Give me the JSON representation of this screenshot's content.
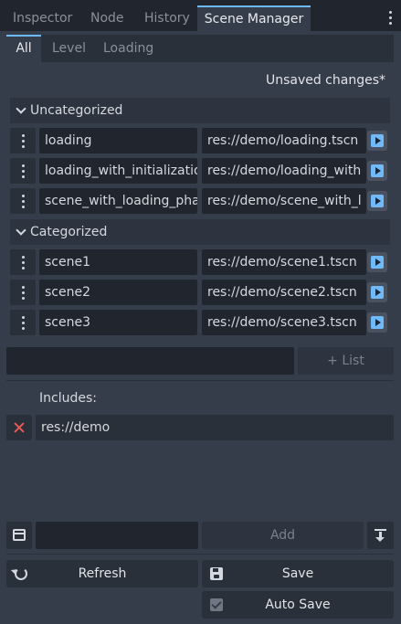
{
  "dock": {
    "tabs": [
      "Inspector",
      "Node",
      "History",
      "Scene Manager"
    ],
    "active_tab": "Scene Manager"
  },
  "sub_tabs": [
    "All",
    "Level",
    "Loading"
  ],
  "status": {
    "unsaved": "Unsaved changes*"
  },
  "sections": [
    {
      "title": "Uncategorized",
      "rows": [
        {
          "name": "loading",
          "path": "res://demo/loading.tscn"
        },
        {
          "name": "loading_with_initializatio",
          "path": "res://demo/loading_with"
        },
        {
          "name": "scene_with_loading_pha",
          "path": "res://demo/scene_with_l"
        }
      ]
    },
    {
      "title": "Categorized",
      "rows": [
        {
          "name": "scene1",
          "path": "res://demo/scene1.tscn"
        },
        {
          "name": "scene2",
          "path": "res://demo/scene2.tscn"
        },
        {
          "name": "scene3",
          "path": "res://demo/scene3.tscn"
        }
      ]
    }
  ],
  "list": {
    "input_value": "",
    "button_label": "+ List"
  },
  "includes": {
    "label": "Includes:",
    "items": [
      "res://demo"
    ]
  },
  "add": {
    "input_value": "",
    "button_label": "Add"
  },
  "actions": {
    "refresh": "Refresh",
    "save": "Save",
    "auto_save": "Auto Save",
    "auto_save_checked": true
  },
  "icons": {
    "menu": "vertical-dots-icon",
    "collapse": "chevron-down-icon",
    "drag": "vertical-dots-icon",
    "play": "play-icon",
    "remove": "close-x-icon",
    "folder": "folder-icon",
    "sort": "arrow-bottom-icon",
    "refresh": "refresh-icon",
    "save": "floppy-disk-icon",
    "checkbox": "checkbox-icon"
  },
  "colors": {
    "accent": "#70bafa",
    "remove": "#e85a5a",
    "background": "#363d4a"
  }
}
